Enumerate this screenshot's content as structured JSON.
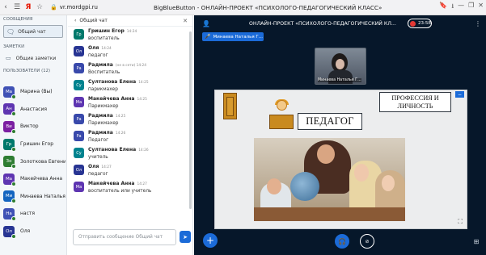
{
  "browser": {
    "back": "‹",
    "menu": "☰",
    "yandex": "Я",
    "star": "☆",
    "url": "vr.mordgpi.ru",
    "title": "BigBlueButton - ОНЛАЙН-ПРОЕКТ «ПСИХОЛОГО-ПЕДАГОГИЧЕСКИЙ КЛАСС»",
    "bookmark_icon": "bookmark-icon",
    "download_icon": "download-icon",
    "min": "—",
    "max": "❐",
    "close": "✕"
  },
  "sidebar": {
    "messages_header": "СООБЩЕНИЯ",
    "public_chat": "Общий чат",
    "notes_header": "ЗАМЕТКИ",
    "shared_notes": "Общие заметки",
    "users_header": "ПОЛЬЗОВАТЕЛИ (12)",
    "users": [
      {
        "initials": "Ма",
        "name": "Марина (Вы)",
        "color": "#3f51b5"
      },
      {
        "initials": "Ан",
        "name": "Анастасия",
        "color": "#5e35b1"
      },
      {
        "initials": "Ви",
        "name": "Виктор",
        "color": "#7b1fa2"
      },
      {
        "initials": "Гр",
        "name": "Гришин Егор",
        "color": "#00796b"
      },
      {
        "initials": "Зо",
        "name": "Золоткова Евгени...",
        "color": "#2e7d32"
      },
      {
        "initials": "Ма",
        "name": "Макейчева Анна",
        "color": "#5e35b1"
      },
      {
        "initials": "Ми",
        "name": "Минаева Наталья...",
        "color": "#1565c0"
      },
      {
        "initials": "На",
        "name": "настя",
        "color": "#3f51b5"
      },
      {
        "initials": "Ол",
        "name": "Оля",
        "color": "#283593"
      }
    ]
  },
  "chat": {
    "title": "Общий чат",
    "back": "‹",
    "close": "✕",
    "input_placeholder": "Отправить сообщение Общий чат",
    "send_icon": "➤",
    "messages": [
      {
        "initials": "Гр",
        "name": "Гришин Егор",
        "time": "14:24",
        "text": "воспитатель",
        "color": "#00796b"
      },
      {
        "initials": "Ол",
        "name": "Оля",
        "time": "14:24",
        "text": "педагог",
        "color": "#283593"
      },
      {
        "initials": "Ра",
        "name": "Радмила",
        "time": "(не в сети)  14:24",
        "text": "Воспитатель",
        "color": "#3949ab"
      },
      {
        "initials": "Су",
        "name": "Султанова Елена",
        "time": "14:25",
        "text": "парикмахер",
        "color": "#00838f"
      },
      {
        "initials": "Ма",
        "name": "Макейчева Анна",
        "time": "14:25",
        "text": "Парикмахер",
        "color": "#5e35b1"
      },
      {
        "initials": "Ра",
        "name": "Радмила",
        "time": "14:25",
        "text": "Парикмахер",
        "color": "#3949ab"
      },
      {
        "initials": "Ра",
        "name": "Радмила",
        "time": "14:26",
        "text": "Педагог",
        "color": "#3949ab"
      },
      {
        "initials": "Су",
        "name": "Султанова Елена",
        "time": "14:26",
        "text": "учитель",
        "color": "#00838f"
      },
      {
        "initials": "Ол",
        "name": "Оля",
        "time": "14:27",
        "text": "педагог",
        "color": "#283593"
      },
      {
        "initials": "Ма",
        "name": "Макейчева Анна",
        "time": "14:27",
        "text": "воспитатель или учитель",
        "color": "#5e35b1"
      }
    ]
  },
  "main": {
    "user_icon": "👤",
    "title": "ОНЛАЙН-ПРОЕКТ «ПСИХОЛОГО-ПЕДАГОГИЧЕСКИЙ КЛ...",
    "timer": "23:58",
    "more": "⋮",
    "talker": "Минаева Наталья Г...",
    "mic": "🎤",
    "webcam_label": "Минаева Наталья Г...",
    "slide": {
      "heading": "ПЕДАГОГ",
      "profession_line1": "ПРОФЕССИЯ И",
      "profession_line2": "ЛИЧНОСТЬ",
      "min_btn": "−",
      "fullscreen": "⛶"
    },
    "controls": {
      "plus": "+",
      "audio": "🎧",
      "camera": "⊘",
      "side": "⊞"
    }
  },
  "colors": {
    "accent": "#1b6bd8",
    "main_bg": "#06172a",
    "online": "#2e7d32",
    "record": "#e53935"
  }
}
